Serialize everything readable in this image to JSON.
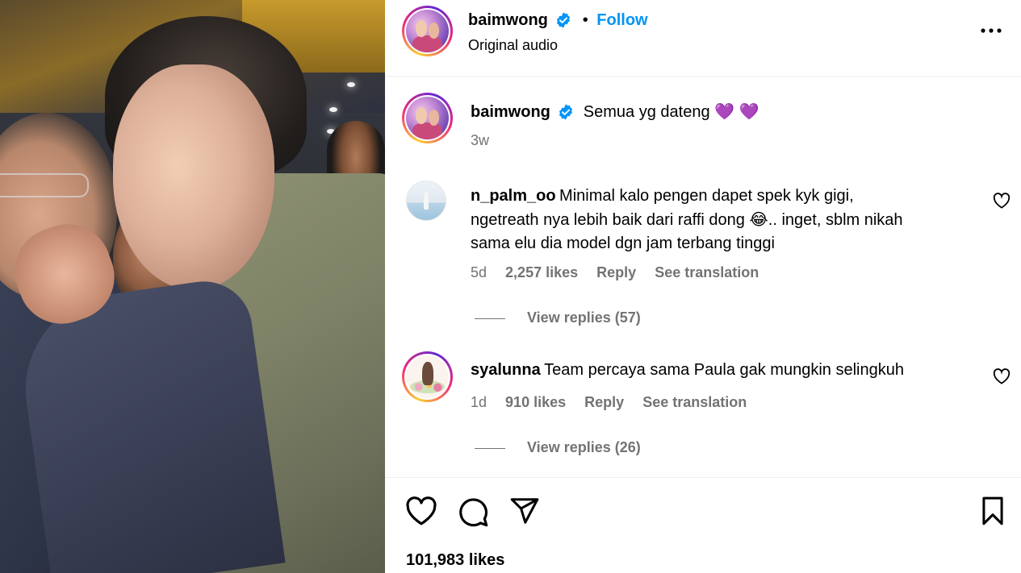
{
  "post": {
    "author": "baimwong",
    "follow_label": "Follow",
    "separator": "•",
    "audio": "Original audio",
    "caption_user": "baimwong",
    "caption_text": "Semua yg dateng 💜 💜",
    "caption_age": "3w",
    "likes": "101,983 likes"
  },
  "comments": [
    {
      "user": "n_palm_oo",
      "lines": [
        "Minimal kalo pengen dapet spek kyk gigi,",
        "ngetreath nya lebih baik dari raffi dong 😂.. inget, sblm nikah",
        "sama elu dia model dgn jam terbang tinggi"
      ],
      "age": "5d",
      "likes": "2,257 likes",
      "reply_label": "Reply",
      "translate_label": "See translation",
      "view_replies": "View replies (57)"
    },
    {
      "user": "syalunna",
      "text": "Team percaya sama Paula gak mungkin selingkuh",
      "age": "1d",
      "likes": "910 likes",
      "reply_label": "Reply",
      "translate_label": "See translation",
      "view_replies": "View replies (26)"
    }
  ],
  "icons": {
    "more": "more-options-icon",
    "verified": "verified-badge-icon",
    "heart": "heart-icon",
    "comment": "comment-icon",
    "share": "share-icon",
    "save": "bookmark-icon"
  },
  "colors": {
    "link": "#0095f6",
    "verified": "#0095f6",
    "secondary_text": "#737373"
  }
}
